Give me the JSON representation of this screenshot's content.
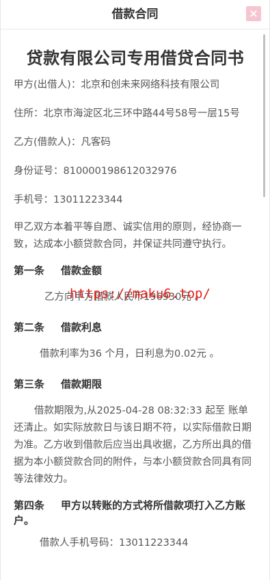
{
  "window": {
    "title": "借款合同",
    "close_glyph": "×"
  },
  "document": {
    "heading": "贷款有限公司专用借贷合同书",
    "lender": "甲方(出借人)：北京和创未来网络科技有限公司",
    "address": "住所：北京市海淀区北三环中路44号58号一层15号",
    "borrower": "乙方(借款人)：凡客码",
    "id_number": "身份证号：810000198612032976",
    "phone": "手机号：13011223344",
    "intro": "甲乙双方本着平等自愿、诚实信用的原则，经协商一致，达成本小额贷款合同，并保证共同遵守执行。",
    "articles": [
      {
        "number": "第一条",
        "title": "借款金额",
        "body": "乙方向甲方借款人民币196930元 。"
      },
      {
        "number": "第二条",
        "title": "借款利息",
        "body": "借款利率为36 个月，日利息为0.02元 。"
      },
      {
        "number": "第三条",
        "title": "借款期限",
        "body": "借款期限为,从2025-04-28 08:32:33 起至 账单还清止。如实际放款日与该日期不符，以实际借款日期为准。乙方收到借款后应当出具收据，乙方所出具的借据为本小额贷款合同的附件，与本小额贷款合同具有同等法律效力。"
      },
      {
        "number": "第四条",
        "title": "甲方以转账的方式将所借款项打入乙方账户。",
        "body": "借款人手机号码：13011223344"
      }
    ]
  },
  "watermark": {
    "text": "https://maku6.top/",
    "color": "#e0201a"
  },
  "colors": {
    "close_button_bg": "#f6c5cf",
    "title_text": "#333333",
    "body_text": "#555555"
  }
}
